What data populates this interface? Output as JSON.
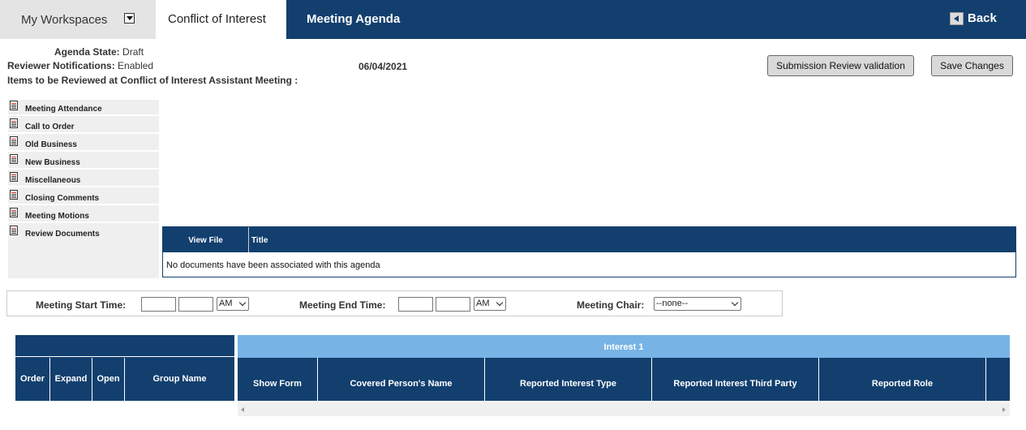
{
  "header": {
    "workspaces_label": "My Workspaces",
    "tab_coi": "Conflict of Interest",
    "tab_meeting": "Meeting Agenda",
    "back_label": "Back"
  },
  "info": {
    "agenda_state_label": "Agenda State:",
    "agenda_state_value": "Draft",
    "notifications_label": "Reviewer Notifications:",
    "notifications_value": "Enabled",
    "items_label": "Items to be Reviewed at Conflict of Interest Assistant Meeting :",
    "date": "06/04/2021"
  },
  "buttons": {
    "validate": "Submission Review validation",
    "save": "Save Changes"
  },
  "menu": {
    "items": [
      {
        "label": "Meeting Attendance"
      },
      {
        "label": "Call to Order"
      },
      {
        "label": "Old Business"
      },
      {
        "label": "New Business"
      },
      {
        "label": "Miscellaneous"
      },
      {
        "label": "Closing Comments"
      },
      {
        "label": "Meeting Motions"
      },
      {
        "label": "Review Documents"
      }
    ]
  },
  "documents": {
    "col_view": "View File",
    "col_title": "Title",
    "empty": "No documents have been associated with this agenda"
  },
  "times": {
    "start_label": "Meeting Start Time:",
    "end_label": "Meeting End Time:",
    "chair_label": "Meeting Chair:",
    "start_ampm": "AM",
    "end_ampm": "AM",
    "chair_value": "--none--"
  },
  "grid": {
    "left_columns": [
      "Order",
      "Expand",
      "Open",
      "Group Name"
    ],
    "interest_header": "Interest 1",
    "right_columns": [
      "Show Form",
      "Covered Person's Name",
      "Reported Interest Type",
      "Reported Interest Third Party",
      "Reported Role"
    ]
  },
  "colors": {
    "navy": "#123f6e",
    "light_blue": "#78b3e6"
  }
}
